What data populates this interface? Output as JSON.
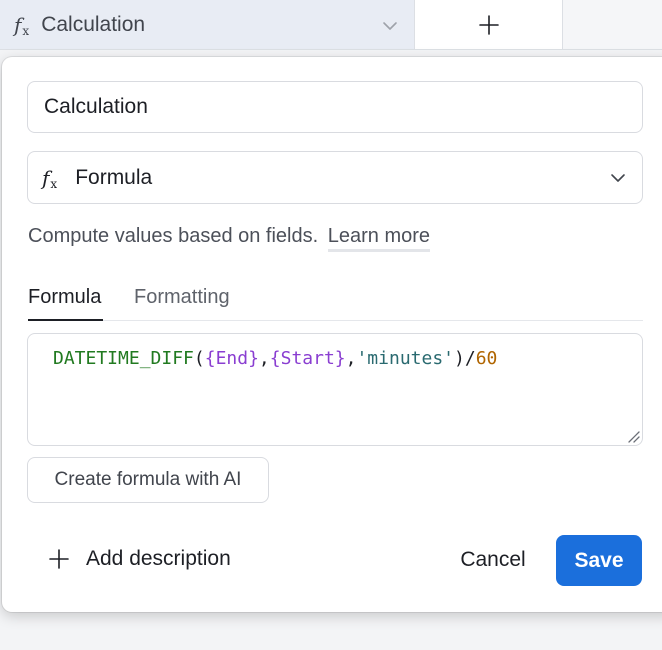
{
  "grid_header": {
    "field_name": "Calculation",
    "field_icon": "formula-fx-icon",
    "add_column_icon": "plus-icon"
  },
  "popup": {
    "name_input_value": "Calculation",
    "field_type": {
      "icon": "formula-fx-icon",
      "label": "Formula"
    },
    "description_text": "Compute values based on fields.",
    "learn_more_label": "Learn more",
    "tabs": [
      {
        "label": "Formula",
        "active": true
      },
      {
        "label": "Formatting",
        "active": false
      }
    ],
    "formula": {
      "tokens": [
        {
          "text": "DATETIME_DIFF",
          "kind": "function"
        },
        {
          "text": "(",
          "kind": "punctuation"
        },
        {
          "text": "{End}",
          "kind": "field"
        },
        {
          "text": ",",
          "kind": "punctuation"
        },
        {
          "text": "{Start}",
          "kind": "field"
        },
        {
          "text": ",",
          "kind": "punctuation"
        },
        {
          "text": "'minutes'",
          "kind": "string"
        },
        {
          "text": ")/",
          "kind": "punctuation"
        },
        {
          "text": "60",
          "kind": "number"
        }
      ]
    },
    "ai_button_label": "Create formula with AI",
    "add_description_label": "Add description",
    "cancel_label": "Cancel",
    "save_label": "Save"
  },
  "colors": {
    "save_button": "#1b6fdc",
    "function_token": "#217a20",
    "field_token": "#8a3ed1",
    "string_token": "#2a6a70",
    "number_token": "#b06500"
  }
}
